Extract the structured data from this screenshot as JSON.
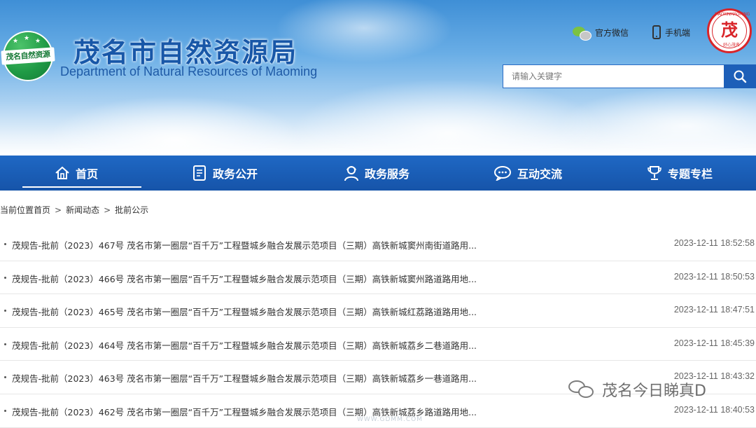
{
  "header": {
    "title_cn": "茂名市自然资源局",
    "title_en": "Department of Natural Resources of Maoming",
    "emblem_text": "茂名自然资源",
    "wechat_label": "官方微信",
    "mobile_label": "手机端",
    "seal_top_text": "MAOXINMAOMING",
    "seal_bottom_text": "好心茂名"
  },
  "search": {
    "placeholder": "请输入关键字"
  },
  "nav": {
    "items": [
      {
        "label": "首页",
        "icon": "home-icon"
      },
      {
        "label": "政务公开",
        "icon": "document-icon"
      },
      {
        "label": "政务服务",
        "icon": "service-person-icon"
      },
      {
        "label": "互动交流",
        "icon": "chat-icon"
      },
      {
        "label": "专题专栏",
        "icon": "trophy-icon"
      }
    ]
  },
  "breadcrumb": {
    "prefix": "当前位置",
    "items": [
      "首页",
      "新闻动态",
      "批前公示"
    ],
    "separator": ">"
  },
  "articles": [
    {
      "title": "茂规告-批前（2023）467号 茂名市第一圈层“百千万”工程暨城乡融合发展示范项目（三期）高铁新城窦州南街道路用...",
      "date": "2023-12-11 18:52:58"
    },
    {
      "title": "茂规告-批前（2023）466号 茂名市第一圈层“百千万”工程暨城乡融合发展示范项目（三期）高铁新城窦州路道路用地...",
      "date": "2023-12-11 18:50:53"
    },
    {
      "title": "茂规告-批前（2023）465号 茂名市第一圈层“百千万”工程暨城乡融合发展示范项目（三期）高铁新城红荔路道路用地...",
      "date": "2023-12-11 18:47:51"
    },
    {
      "title": "茂规告-批前（2023）464号 茂名市第一圈层“百千万”工程暨城乡融合发展示范项目（三期）高铁新城荔乡二巷道路用...",
      "date": "2023-12-11 18:45:39"
    },
    {
      "title": "茂规告-批前（2023）463号 茂名市第一圈层“百千万”工程暨城乡融合发展示范项目（三期）高铁新城荔乡一巷道路用...",
      "date": "2023-12-11 18:43:32"
    },
    {
      "title": "茂规告-批前（2023）462号 茂名市第一圈层“百千万”工程暨城乡融合发展示范项目（三期）高铁新城荔乡路道路用地...",
      "date": "2023-12-11 18:40:53"
    }
  ],
  "watermark": {
    "text": "茂名今日睇真D",
    "site": "WWW.GDMM.COM"
  },
  "colors": {
    "nav_bg": "#1a5fb8",
    "title_blue": "#1857a8",
    "emblem_green": "#1f9a45",
    "seal_red": "#d9252a"
  }
}
